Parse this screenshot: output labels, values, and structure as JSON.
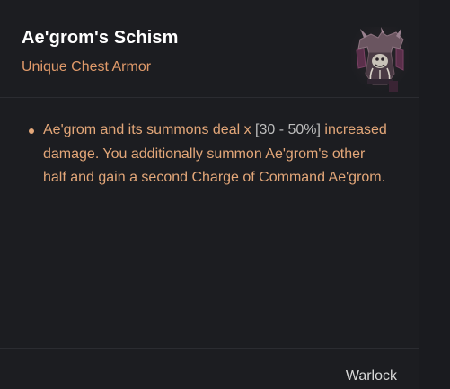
{
  "item": {
    "name": "Ae'grom's Schism",
    "type": "Unique Chest Armor"
  },
  "mods": [
    {
      "prefix": "Ae'grom and its summons deal x ",
      "range": "[30 - 50%]",
      "suffix": " increased damage. You additionally summon Ae'grom's other half and gain a second Charge of Command Ae'grom."
    }
  ],
  "footer": {
    "class": "Warlock"
  },
  "colors": {
    "background": "#1c1d21",
    "item_type": "#e09a6a",
    "mod_text": "#e3a779",
    "range_text": "#bdbdbd",
    "title": "#ffffff"
  },
  "icons": {
    "item_image": "chest-armor-icon"
  }
}
